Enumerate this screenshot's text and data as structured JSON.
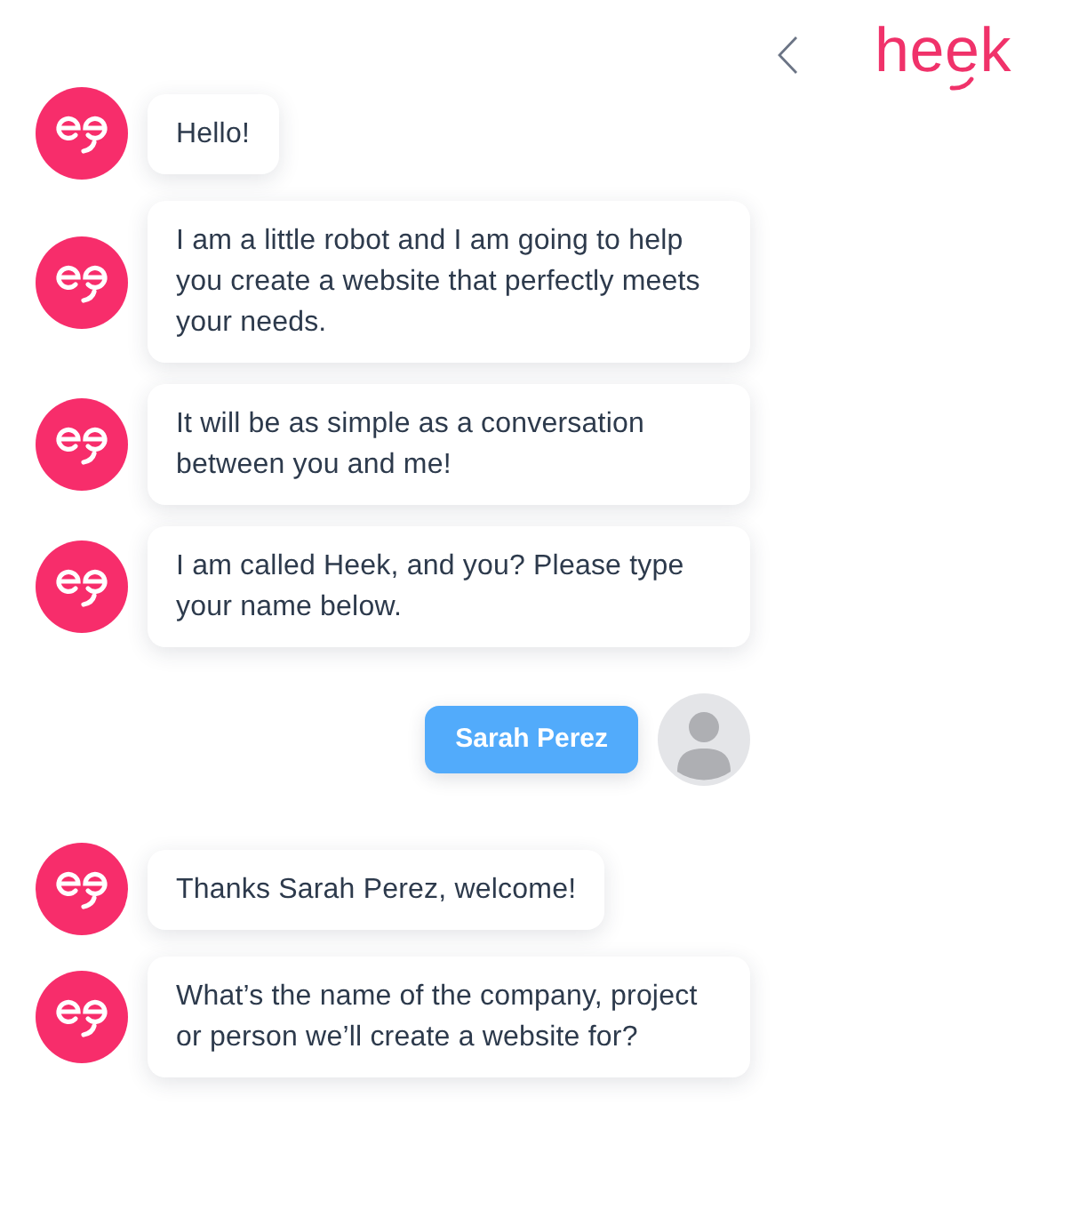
{
  "header": {
    "logo": "heek"
  },
  "messages": [
    {
      "kind": "bot",
      "text": "Hello!"
    },
    {
      "kind": "bot",
      "text": "I am a little robot and I am going to help you create a website that perfectly meets your needs."
    },
    {
      "kind": "bot",
      "text": "It will be as simple as a conversation between you and me!"
    },
    {
      "kind": "bot",
      "text": "I am called Heek, and you? Please type your name below."
    },
    {
      "kind": "user",
      "text": "Sarah Perez"
    },
    {
      "kind": "bot",
      "text": "Thanks Sarah Perez, welcome!"
    },
    {
      "kind": "bot",
      "text": "What’s the name of the company, project or person we’ll create a website for?"
    }
  ]
}
